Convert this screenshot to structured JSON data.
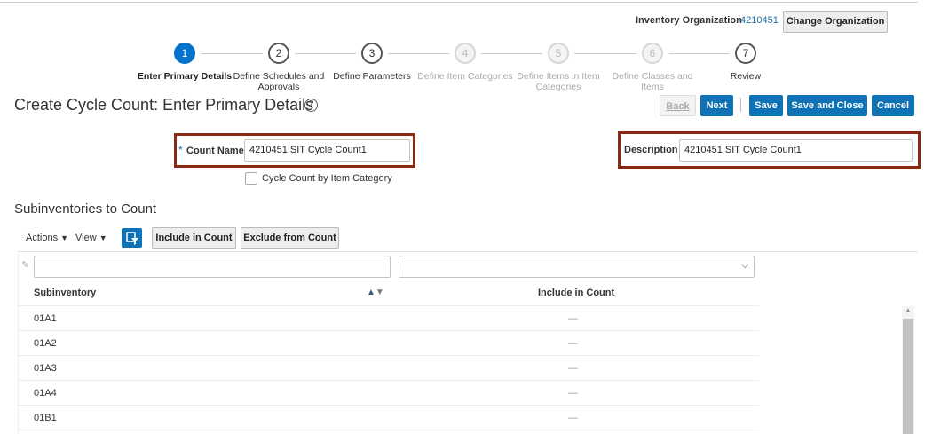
{
  "header": {
    "org_label": "Inventory Organization",
    "org_value": "4210451",
    "change_org_button": "Change Organization"
  },
  "train": {
    "steps": [
      {
        "number": "1",
        "label": "Enter Primary Details",
        "state": "active"
      },
      {
        "number": "2",
        "label": "Define Schedules and Approvals",
        "state": "enabled"
      },
      {
        "number": "3",
        "label": "Define Parameters",
        "state": "enabled"
      },
      {
        "number": "4",
        "label": "Define Item Categories",
        "state": "disabled"
      },
      {
        "number": "5",
        "label": "Define Items in Item Categories",
        "state": "disabled"
      },
      {
        "number": "6",
        "label": "Define Classes and Items",
        "state": "disabled"
      },
      {
        "number": "7",
        "label": "Review",
        "state": "enabled"
      }
    ]
  },
  "page": {
    "title": "Create Cycle Count: Enter Primary Details",
    "help_icon": "?"
  },
  "actions": {
    "back": "Back",
    "next": "Next",
    "save": "Save",
    "save_close": "Save and Close",
    "cancel": "Cancel"
  },
  "form": {
    "required_marker": "*",
    "count_name_label": "Count Name",
    "count_name_value": "4210451 SIT Cycle Count1",
    "description_label": "Description",
    "description_value": "4210451 SIT Cycle Count1",
    "checkbox_label": "Cycle Count by Item Category",
    "checkbox_checked": false
  },
  "section": {
    "title": "Subinventories to Count",
    "actions_menu": "Actions",
    "view_menu": "View",
    "include_button": "Include in Count",
    "exclude_button": "Exclude from Count"
  },
  "table": {
    "columns": [
      "Subinventory",
      "Include in Count"
    ],
    "rows": [
      {
        "subinventory": "01A1",
        "include": "—"
      },
      {
        "subinventory": "01A2",
        "include": "—"
      },
      {
        "subinventory": "01A3",
        "include": "—"
      },
      {
        "subinventory": "01A4",
        "include": "—"
      },
      {
        "subinventory": "01B1",
        "include": "—"
      }
    ]
  },
  "colors": {
    "accent": "#0e72b5",
    "highlight": "#8b2a14"
  }
}
